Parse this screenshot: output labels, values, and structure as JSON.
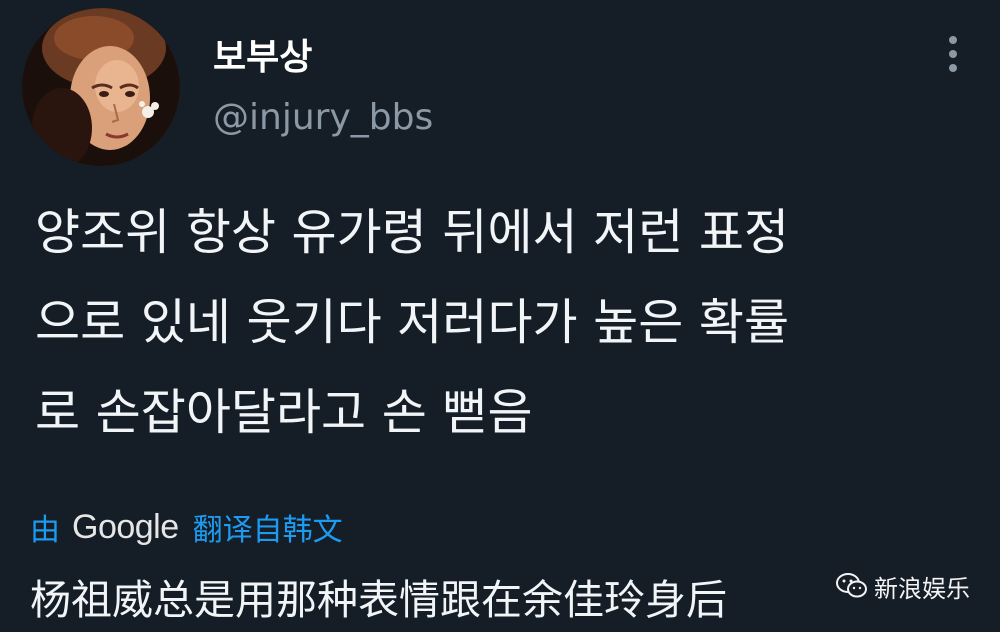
{
  "tweet": {
    "author": {
      "display_name": "보부상",
      "handle": "@injury_bbs",
      "avatar_icon": "avatar-portrait"
    },
    "more_icon": "more-vertical-icon",
    "text_lines": [
      "양조위 항상 유가령 뒤에서 저런 표정",
      "으로 있네 웃기다 저러다가 높은 확률",
      "로 손잡아달라고 손 뻗음"
    ],
    "translation": {
      "by_label": "由",
      "provider": "Google",
      "link_label": "翻译自韩文",
      "text": "杨祖威总是用那种表情跟在余佳玲身后"
    }
  },
  "watermark": {
    "icon": "wechat-icon",
    "label": "新浪娱乐"
  },
  "colors": {
    "background": "#151d26",
    "link": "#1d9bf0",
    "secondary_text": "#8b98a5",
    "primary_text": "#f2f5f7"
  }
}
